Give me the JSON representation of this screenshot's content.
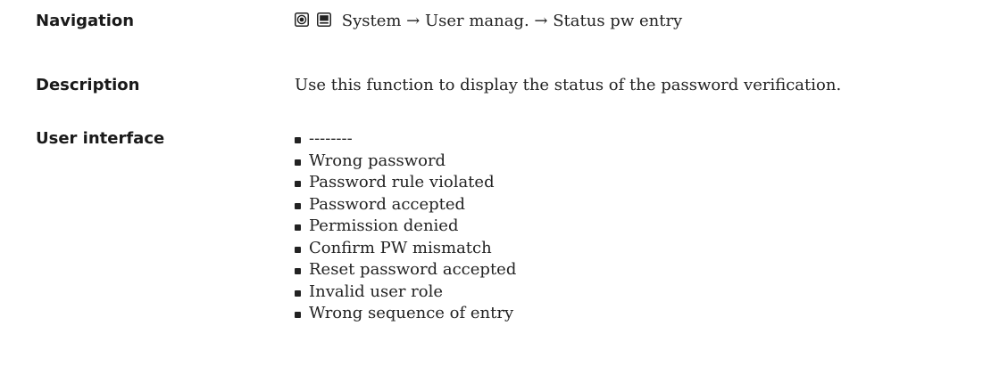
{
  "navigation": {
    "label": "Navigation",
    "icons": [
      "operating-tool-icon",
      "display-icon"
    ],
    "path": "System → User manag. → Status pw entry"
  },
  "description": {
    "label": "Description",
    "text": "Use this function to display the status of the password verification."
  },
  "user_interface": {
    "label": "User interface",
    "items": [
      "--------",
      "Wrong password",
      "Password rule violated",
      "Password accepted",
      "Permission denied",
      "Confirm PW mismatch",
      "Reset password accepted",
      "Invalid user role",
      "Wrong sequence of entry"
    ]
  }
}
